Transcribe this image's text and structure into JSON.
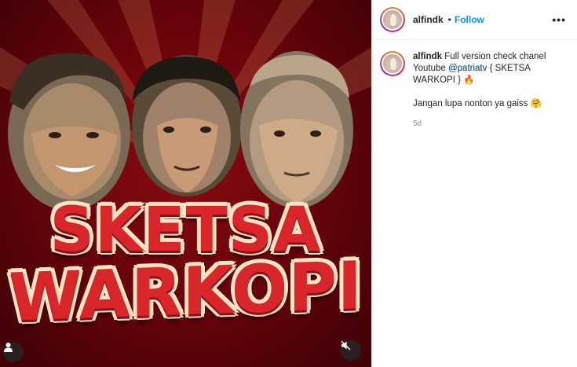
{
  "post": {
    "media": {
      "title_line1": "SKETSA",
      "title_line2": "WARKOPI",
      "user_tag_icon": "person-icon",
      "mute_icon": "speaker-muted-icon"
    },
    "author": {
      "username": "alfindk",
      "separator": "•",
      "follow_label": "Follow",
      "more_label": "•••"
    },
    "caption": {
      "username": "alfindk",
      "text_before_mention": "Full version check chanel Youtube ",
      "mention": "@patriatv",
      "text_after_mention": " { SKETSA WARKOPI } 🔥",
      "second_line": "Jangan lupa nonton ya gaiss 🤗",
      "timestamp": "5d"
    }
  },
  "colors": {
    "accent_blue": "#0095f6",
    "background_red": "#6a040b",
    "title_red": "#d9262b",
    "title_outline": "#f6e3c3"
  }
}
